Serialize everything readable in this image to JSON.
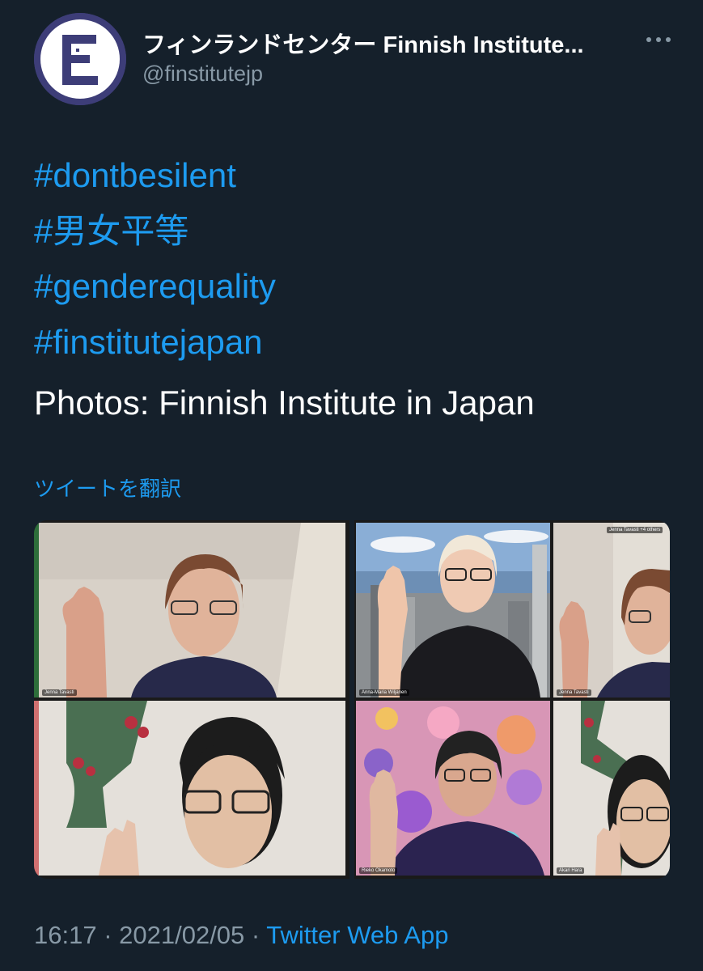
{
  "account": {
    "display_name": "フィンランドセンター Finnish Institute...",
    "handle": "@finstitutejp",
    "avatar_icon": "finnish-institute-logo"
  },
  "tweet": {
    "hashtags": [
      "#dontbesilent",
      "#男女平等",
      "#genderequality",
      "#finstitutejapan"
    ],
    "caption": "Photos: Finnish Institute in Japan",
    "translate_label": "ツイートを翻訳"
  },
  "media": {
    "photo1": {
      "tiles": [
        "Jenna Tavasti",
        "",
        "",
        ""
      ]
    },
    "photo2": {
      "top_banner": "Jenna Tavasti +4 others",
      "tiles": [
        "Anna-Maria Wiljanen",
        "Jenna Tavasti",
        "Rieko Okamoto",
        "Akari Hara"
      ]
    }
  },
  "meta": {
    "time": "16:17",
    "separator": " · ",
    "date": "2021/02/05",
    "source": "Twitter Web App"
  },
  "colors": {
    "background": "#15202b",
    "link": "#1d9bf0",
    "secondary": "#8899a6"
  }
}
